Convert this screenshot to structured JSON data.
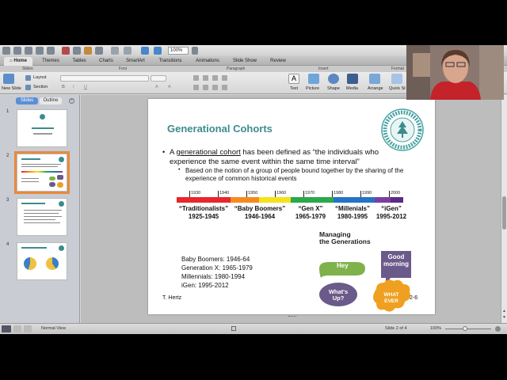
{
  "toolbar": {
    "zoom": "100%"
  },
  "ribbon_tabs": [
    {
      "label": "Home",
      "active": true
    },
    {
      "label": "Themes"
    },
    {
      "label": "Tables"
    },
    {
      "label": "Charts"
    },
    {
      "label": "SmartArt"
    },
    {
      "label": "Transitions"
    },
    {
      "label": "Animations"
    },
    {
      "label": "Slide Show"
    },
    {
      "label": "Review"
    }
  ],
  "ribbon_groups": {
    "slides": "Slides",
    "font": "Font",
    "paragraph": "Paragraph",
    "insert": "Insert",
    "format": "Format"
  },
  "ribbon": {
    "new_slide": "New Slide",
    "layout": "Layout",
    "section": "Section",
    "text": "Text",
    "picture": "Picture",
    "shape": "Shape",
    "media": "Media",
    "arrange": "Arrange",
    "quick_styles": "Quick St"
  },
  "left_pane": {
    "tab_slides": "Slides",
    "tab_outline": "Outline",
    "thumb_numbers": [
      "1",
      "2",
      "3",
      "4"
    ]
  },
  "slide": {
    "title": "Generational Cohorts",
    "bullet1_pre": "A ",
    "bullet1_term": "generational cohort",
    "bullet1_post": " has been defined as “the individuals who experience the same event within the same time interval”",
    "bullet2": "Based on the notion of a group of people bound together by the sharing of the experience of common historical events",
    "timeline_years": [
      "1930",
      "1940",
      "1950",
      "1960",
      "1970",
      "1980",
      "1990",
      "2000"
    ],
    "generations": [
      {
        "name": "“Traditionalists”",
        "years": "1925-1945"
      },
      {
        "name": "“Baby Boomers”",
        "years": "1946-1964"
      },
      {
        "name": "“Gen X”",
        "years": "1965-1979"
      },
      {
        "name": "“Millenials”",
        "years": "1980-1995"
      },
      {
        "name": "“iGen”",
        "years": "1995-2012"
      }
    ],
    "list": [
      "Baby Boomers: 1946-64",
      "Generation X: 1965-1979",
      "Millennials: 1980-1994",
      "iGen: 1995-2012"
    ],
    "graphic": {
      "title_line1": "Managing",
      "title_line2": "the Generations",
      "bubble_good1": "Good",
      "bubble_good2": "morning",
      "bubble_hey": "Hey",
      "bubble_whats1": "What's",
      "bubble_whats2": "Up?",
      "bubble_whatever1": "WHAT",
      "bubble_whatever2": "EVER"
    },
    "footer_left": "T. Hertz",
    "footer_right": "2-6"
  },
  "statusbar": {
    "view": "Normal View",
    "slide_pos": "Slide 2 of 4",
    "zoom": "100%"
  },
  "colors": {
    "title": "#3d8c8c",
    "accent_selection": "#e88a3c",
    "timeline": [
      "#e8262b",
      "#f58b1f",
      "#f4e21b",
      "#2aa84a",
      "#2473c6",
      "#7a3fa0",
      "#5b2a86"
    ]
  }
}
